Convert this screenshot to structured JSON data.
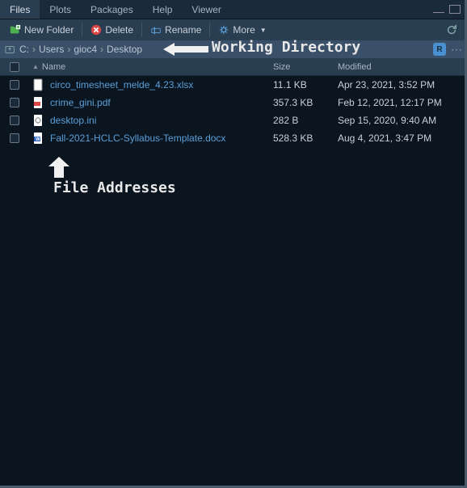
{
  "tabs": [
    "Files",
    "Plots",
    "Packages",
    "Help",
    "Viewer"
  ],
  "active_tab": 0,
  "toolbar": {
    "new_folder": "New Folder",
    "delete": "Delete",
    "rename": "Rename",
    "more": "More"
  },
  "breadcrumb": {
    "root": "C:",
    "items": [
      "Users",
      "gioc4",
      "Desktop"
    ]
  },
  "columns": {
    "name": "Name",
    "size": "Size",
    "modified": "Modified"
  },
  "files": [
    {
      "name": "circo_timesheet_melde_4.23.xlsx",
      "size": "11.1 KB",
      "modified": "Apr 23, 2021, 3:52 PM",
      "type": "xlsx"
    },
    {
      "name": "crime_gini.pdf",
      "size": "357.3 KB",
      "modified": "Feb 12, 2021, 12:17 PM",
      "type": "pdf"
    },
    {
      "name": "desktop.ini",
      "size": "282 B",
      "modified": "Sep 15, 2020, 9:40 AM",
      "type": "ini"
    },
    {
      "name": "Fall-2021-HCLC-Syllabus-Template.docx",
      "size": "528.3 KB",
      "modified": "Aug 4, 2021, 3:47 PM",
      "type": "docx"
    }
  ],
  "annotations": {
    "working_dir": "Working Directory",
    "file_addr": "File Addresses"
  }
}
